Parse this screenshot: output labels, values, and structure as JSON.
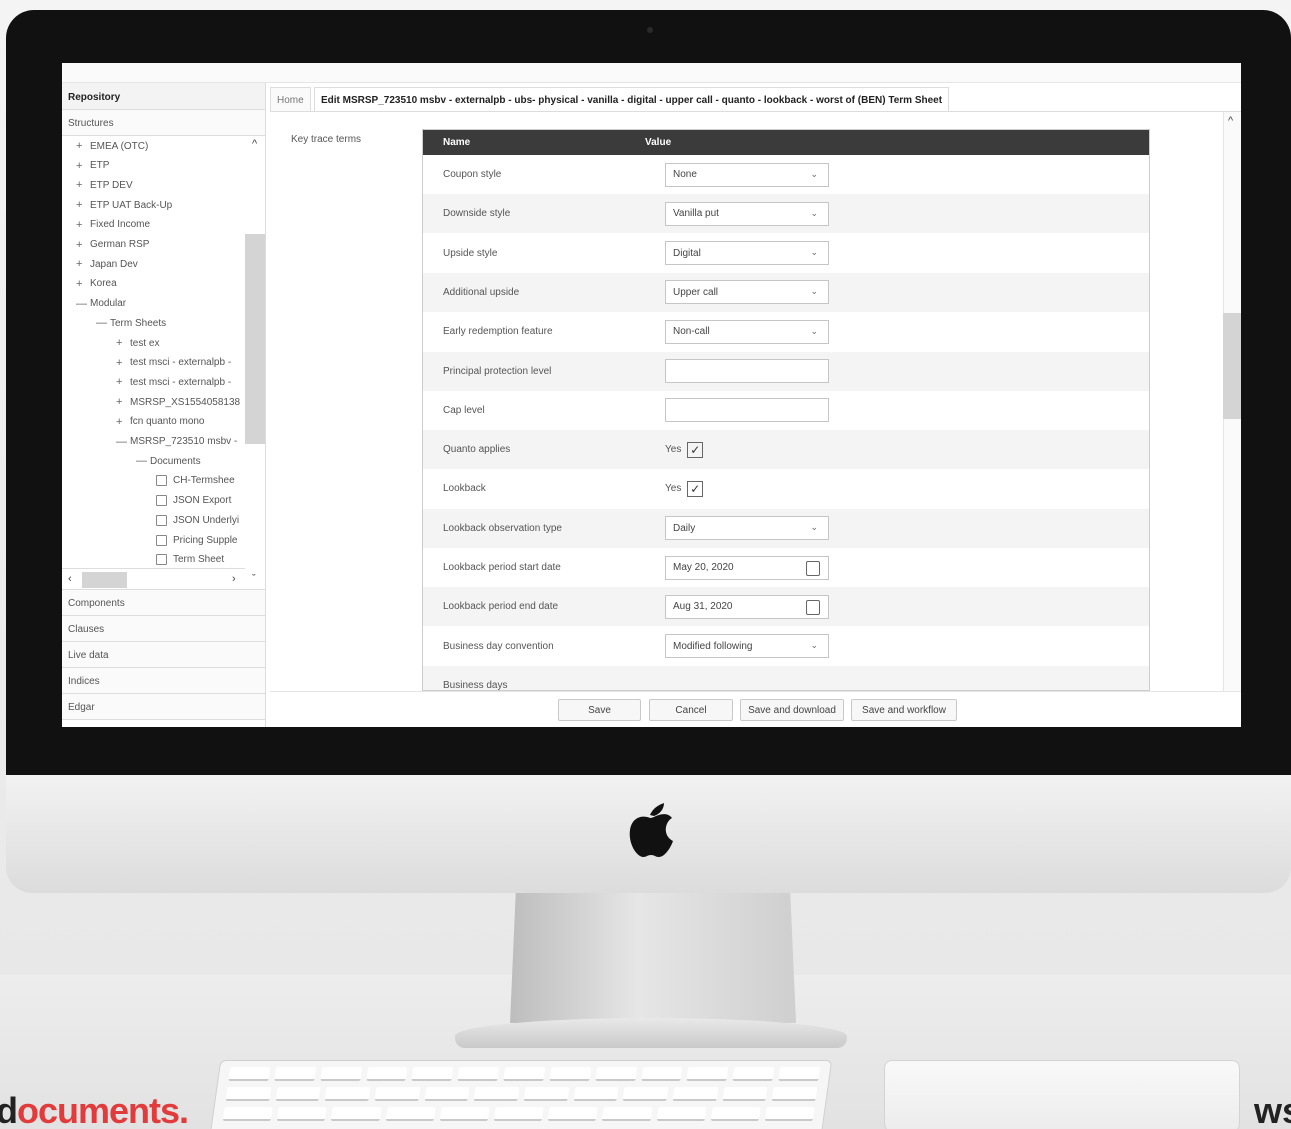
{
  "repository": {
    "title": "Repository",
    "structures_label": "Structures",
    "tree": [
      {
        "label": "EMEA (OTC)",
        "expander": "+"
      },
      {
        "label": "ETP",
        "expander": "+"
      },
      {
        "label": "ETP DEV",
        "expander": "+"
      },
      {
        "label": "ETP UAT Back-Up",
        "expander": "+"
      },
      {
        "label": "Fixed Income",
        "expander": "+"
      },
      {
        "label": "German RSP",
        "expander": "+"
      },
      {
        "label": "Japan Dev",
        "expander": "+"
      },
      {
        "label": "Korea",
        "expander": "+"
      },
      {
        "label": "Modular",
        "expander": "—"
      },
      {
        "label": "Term Sheets",
        "expander": "—"
      },
      {
        "label": "test ex",
        "expander": "+"
      },
      {
        "label": "test msci - externalpb -",
        "expander": "+"
      },
      {
        "label": "test msci - externalpb -",
        "expander": "+"
      },
      {
        "label": "MSRSP_XS1554058138",
        "expander": "+"
      },
      {
        "label": "fcn quanto mono",
        "expander": "+"
      },
      {
        "label": "MSRSP_723510 msbv -",
        "expander": "—"
      },
      {
        "label": "Documents",
        "expander": "—"
      },
      {
        "label": "CH-Termshee",
        "expander": ""
      },
      {
        "label": "JSON Export",
        "expander": ""
      },
      {
        "label": "JSON Underlyi",
        "expander": ""
      },
      {
        "label": "Pricing Supple",
        "expander": ""
      },
      {
        "label": "Term Sheet",
        "expander": ""
      }
    ],
    "sections": [
      "Components",
      "Clauses",
      "Live data",
      "Indices",
      "Edgar"
    ]
  },
  "tabs": {
    "home": "Home",
    "active": "Edit MSRSP_723510 msbv - externalpb - ubs- physical - vanilla - digital - upper call - quanto - lookback - worst of (BEN) Term Sheet"
  },
  "section_label": "Key trace terms",
  "table": {
    "col_name": "Name",
    "col_value": "Value",
    "rows": [
      {
        "name": "Coupon style",
        "type": "select",
        "value": "None"
      },
      {
        "name": "Downside style",
        "type": "select",
        "value": "Vanilla put"
      },
      {
        "name": "Upside style",
        "type": "select",
        "value": "Digital"
      },
      {
        "name": "Additional upside",
        "type": "select",
        "value": "Upper call"
      },
      {
        "name": "Early redemption feature",
        "type": "select",
        "value": "Non-call"
      },
      {
        "name": "Principal protection level",
        "type": "text",
        "value": ""
      },
      {
        "name": "Cap level",
        "type": "text",
        "value": ""
      },
      {
        "name": "Quanto applies",
        "type": "checkbox",
        "value": "Yes"
      },
      {
        "name": "Lookback",
        "type": "checkbox",
        "value": "Yes"
      },
      {
        "name": "Lookback observation type",
        "type": "select",
        "value": "Daily"
      },
      {
        "name": "Lookback period start date",
        "type": "date",
        "value": "May 20, 2020"
      },
      {
        "name": "Lookback period end date",
        "type": "date",
        "value": "Aug 31, 2020"
      },
      {
        "name": "Business day convention",
        "type": "select",
        "value": "Modified following"
      },
      {
        "name": "Business days",
        "type": "",
        "value": ""
      }
    ]
  },
  "buttons": {
    "save": "Save",
    "cancel": "Cancel",
    "save_download": "Save and download",
    "save_workflow": "Save and workflow"
  },
  "branding": {
    "left_prefix": "d",
    "left_word": "ocuments.",
    "right": "ws"
  }
}
